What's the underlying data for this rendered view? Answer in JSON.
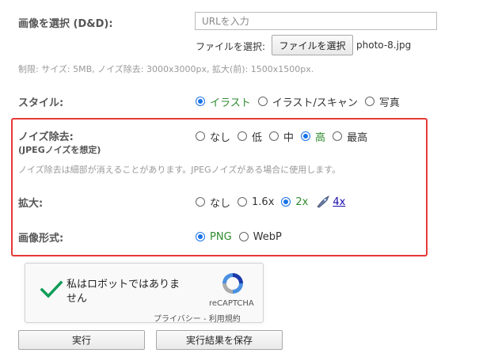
{
  "image_select": {
    "label": "画像を選択 (D&D):",
    "url_placeholder": "URLを入力",
    "file_label": "ファイルを選択:",
    "file_button": "ファイルを選択",
    "file_name": "photo-8.jpg",
    "limits": "制限: サイズ: 5MB, ノイズ除去: 3000x3000px, 拡大(前): 1500x1500px."
  },
  "style": {
    "label": "スタイル:",
    "options": [
      "イラスト",
      "イラスト/スキャン",
      "写真"
    ],
    "selected": 0
  },
  "noise": {
    "label": "ノイズ除去:",
    "sublabel": "(JPEGノイズを想定)",
    "options": [
      "なし",
      "低",
      "中",
      "高",
      "最高"
    ],
    "selected": 3,
    "note": "ノイズ除去は細部が消えることがあります。JPEGノイズがある場合に使用します。"
  },
  "scale": {
    "label": "拡大:",
    "options": [
      "なし",
      "1.6x",
      "2x"
    ],
    "selected": 2,
    "extra_link": "4x",
    "extra_icon": "rocket-icon"
  },
  "format": {
    "label": "画像形式:",
    "options": [
      "PNG",
      "WebP"
    ],
    "selected": 0
  },
  "recaptcha": {
    "text": "私はロボットではありません",
    "brand": "reCAPTCHA",
    "privacy": "プライバシー",
    "separator": " - ",
    "terms": "利用規約"
  },
  "actions": {
    "run": "実行",
    "save": "実行結果を保存"
  },
  "colors": {
    "highlight_border": "#e53935",
    "selected_text": "#2e8b2e",
    "radio_accent": "#1a73e8",
    "checkmark": "#0f9d58"
  }
}
